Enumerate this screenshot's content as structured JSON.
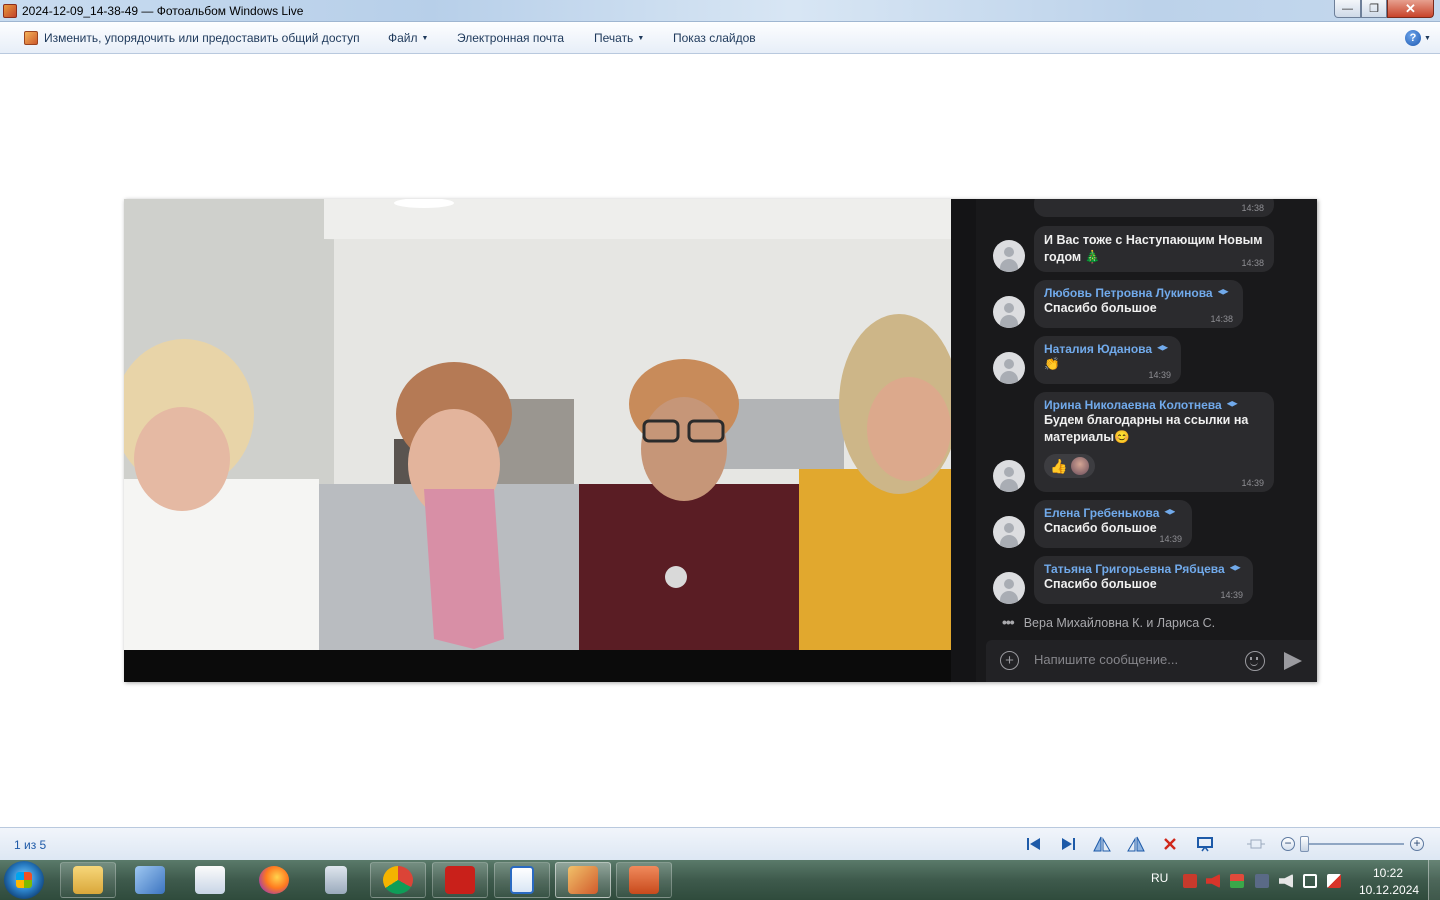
{
  "window": {
    "title": "2024-12-09_14-38-49 — Фотоальбом Windows Live",
    "minimize_glyph": "—",
    "maximize_glyph": "❐",
    "close_glyph": "✕"
  },
  "menu": {
    "share": "Изменить, упорядочить или предоставить общий доступ",
    "file": "Файл",
    "email": "Электронная почта",
    "print": "Печать",
    "slideshow": "Показ слайдов",
    "help": "?"
  },
  "chat": {
    "messages": [
      {
        "sender": "",
        "text": "И Вас тоже с Наступающим Новым годом 🎄",
        "time": "14:38"
      },
      {
        "sender": "Любовь Петровна Лукинова",
        "text": "Спасибо большое",
        "time": "14:38"
      },
      {
        "sender": "Наталия Юданова",
        "text": "👏",
        "time": "14:39"
      },
      {
        "sender": "Ирина Николаевна Колотнева",
        "text": "Будем благодарны на ссылки на материалы😊",
        "time": "14:39",
        "reaction": "👍"
      },
      {
        "sender": "Елена Гребенькова",
        "text": "Спасибо большое",
        "time": "14:39"
      },
      {
        "sender": "Татьяна Григорьевна Рябцева",
        "text": "Спасибо большое",
        "time": "14:39"
      }
    ],
    "top_partial_time": "14:38",
    "typing": "Вера Михайловна К. и Лариса С.",
    "composer_placeholder": "Напишите сообщение..."
  },
  "status": {
    "counter": "1 из 5"
  },
  "taskbar": {
    "language": "RU",
    "time": "10:22",
    "date": "10.12.2024"
  },
  "colors": {
    "sender_name": "#71aaeb",
    "chat_bg": "#19191b",
    "bubble_bg": "#2b2b2e",
    "menu_text": "#1e395b"
  }
}
